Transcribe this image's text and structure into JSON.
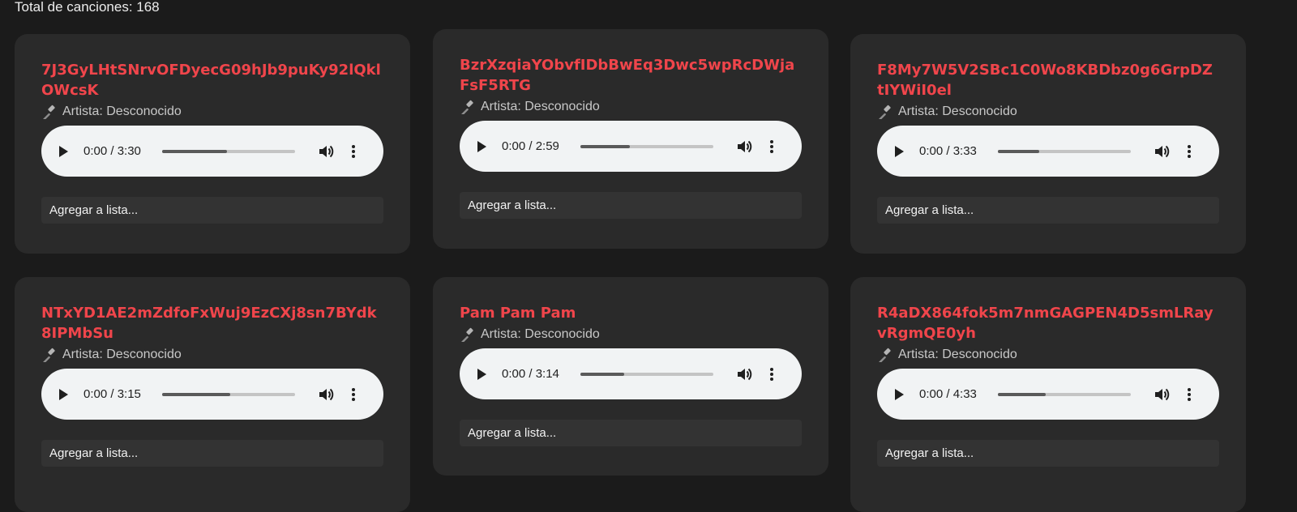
{
  "header": {
    "total_label": "Total de canciones: 168"
  },
  "songs": [
    {
      "title": "7J3GyLHtSNrvOFDyecG09hJb9puKy92lQklOWcsK",
      "artist": "Artista: Desconocido",
      "time": "0:00 / 3:30",
      "progress": 0.49,
      "add_label": "Agregar a lista..."
    },
    {
      "title": "BzrXzqiaYObvfIDbBwEq3Dwc5wpRcDWjaFsF5RTG",
      "artist": "Artista: Desconocido",
      "time": "0:00 / 2:59",
      "progress": 0.37,
      "add_label": "Agregar a lista..."
    },
    {
      "title": "F8My7W5V2SBc1C0Wo8KBDbz0g6GrpDZtIYWiI0el",
      "artist": "Artista: Desconocido",
      "time": "0:00 / 3:33",
      "progress": 0.31,
      "add_label": "Agregar a lista..."
    },
    {
      "title": "NTxYD1AE2mZdfoFxWuj9EzCXj8sn7BYdk8IPMbSu",
      "artist": "Artista: Desconocido",
      "time": "0:00 / 3:15",
      "progress": 0.51,
      "add_label": "Agregar a lista..."
    },
    {
      "title": "Pam Pam Pam",
      "artist": "Artista: Desconocido",
      "time": "0:00 / 3:14",
      "progress": 0.33,
      "add_label": "Agregar a lista..."
    },
    {
      "title": "R4aDX864fok5m7nmGAGPEN4D5smLRayvRgmQE0yh",
      "artist": "Artista: Desconocido",
      "time": "0:00 / 4:33",
      "progress": 0.36,
      "add_label": "Agregar a lista..."
    }
  ],
  "icons": {
    "artist": "hammer-icon",
    "play": "play-icon",
    "volume": "volume-icon",
    "more": "more-options-icon"
  },
  "colors": {
    "title": "#f0454b",
    "background": "#1b1b1b",
    "card": "#2a2a2a",
    "player": "#f1f3f4"
  }
}
